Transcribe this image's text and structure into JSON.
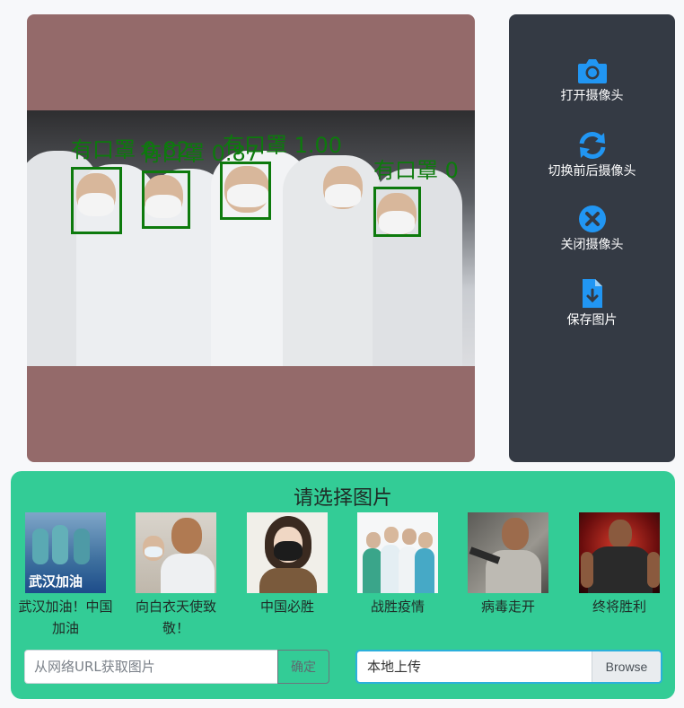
{
  "colors": {
    "canvas_bg": "#946a6a",
    "side_panel_bg": "#343a44",
    "bottom_panel_bg": "#33cc96",
    "icon_blue": "#2196f3",
    "detection_green": "#0d7a0d"
  },
  "detections": [
    {
      "label": "有口罩 0.82"
    },
    {
      "label": "有口罩 0.87"
    },
    {
      "label": "有口罩 1.00"
    },
    {
      "label": "有口罩 0"
    }
  ],
  "side_buttons": [
    {
      "icon": "camera-icon",
      "label": "打开摄像头"
    },
    {
      "icon": "switch-camera-icon",
      "label": "切换前后摄像头"
    },
    {
      "icon": "close-circle-icon",
      "label": "关闭摄像头"
    },
    {
      "icon": "save-file-icon",
      "label": "保存图片"
    }
  ],
  "gallery": {
    "title": "请选择图片",
    "items": [
      {
        "caption": "武汉加油！中国加油",
        "overlay_text": "武汉加油"
      },
      {
        "caption": "向白衣天使致敬！"
      },
      {
        "caption": "中国必胜"
      },
      {
        "caption": "战胜疫情"
      },
      {
        "caption": "病毒走开"
      },
      {
        "caption": "终将胜利"
      }
    ]
  },
  "url_input": {
    "placeholder": "从网络URL获取图片",
    "value": "",
    "confirm_label": "确定"
  },
  "file_upload": {
    "label": "本地上传",
    "browse_label": "Browse"
  }
}
